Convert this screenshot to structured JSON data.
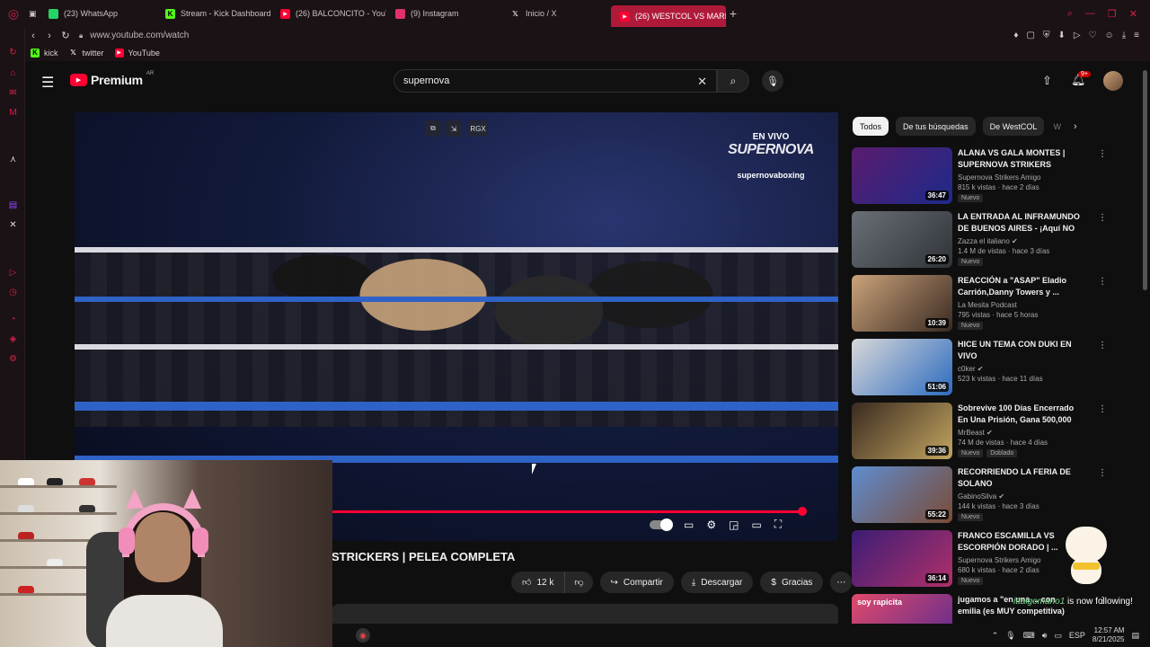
{
  "browser": {
    "tabs": [
      {
        "label": "(23) WhatsApp",
        "icon": "whatsapp-icon",
        "color": "#25d366"
      },
      {
        "label": "Stream - Kick Dashboard",
        "icon": "kick-icon",
        "color": "#53fc18"
      },
      {
        "label": "(26) BALCONCITO - YouT",
        "icon": "youtube-icon",
        "color": "#ff0033"
      },
      {
        "label": "(9) Instagram",
        "icon": "instagram-icon",
        "color": "#e1306c"
      },
      {
        "label": "Inicio / X",
        "icon": "x-icon",
        "color": "#ffffff"
      },
      {
        "label": "(26) WESTCOL VS MARIO",
        "icon": "youtube-icon",
        "color": "#ff0033",
        "active": true
      }
    ],
    "url": "www.youtube.com/watch",
    "bookmarks": [
      {
        "label": "kick",
        "icon": "kick-icon",
        "color": "#53fc18"
      },
      {
        "label": "twitter",
        "icon": "x-icon",
        "color": "#ffffff"
      },
      {
        "label": "YouTube",
        "icon": "youtube-icon",
        "color": "#ff0033"
      }
    ]
  },
  "youtube": {
    "logo_text": "Premium",
    "logo_region": "AR",
    "search_value": "supernova",
    "notification_count": "9+",
    "player": {
      "overlay_label": "RGX",
      "watermark_live": "EN VIVO",
      "watermark_brand": "SUPERNOVA",
      "watermark_handle": "supernovaboxing",
      "progress": 0.99
    },
    "video_title": "STRICKERS | PELEA COMPLETA",
    "actions": {
      "likes": "12 k",
      "share": "Compartir",
      "download": "Descargar",
      "thanks": "Gracias"
    },
    "chips": [
      "Todos",
      "De tus búsquedas",
      "De WestCOL",
      "W"
    ],
    "recommendations": [
      {
        "title": "ALANA VS GALA MONTES | SUPERNOVA STRIKERS AMIGO",
        "channel": "Supernova Strikers Amigo",
        "verified": false,
        "meta": "815 k vistas · hace 2 días",
        "duration": "36:47",
        "badges": [
          "Nuevo"
        ],
        "thumb": [
          "#5a1c6e",
          "#1d2a8a"
        ]
      },
      {
        "title": "LA ENTRADA AL INFRAMUNDO DE BUENOS AIRES - ¡Aquí NO ...",
        "channel": "Zazza el italiano",
        "verified": true,
        "meta": "1.4 M de vistas · hace 3 días",
        "duration": "26:20",
        "badges": [
          "Nuevo"
        ],
        "thumb": [
          "#6a6f77",
          "#2f3338"
        ]
      },
      {
        "title": "REACCIÓN a \"ASAP\" Eladio Carrión,Danny Towers y ...",
        "channel": "La Mesita Podcast",
        "verified": false,
        "meta": "795 vistas · hace 5 horas",
        "duration": "10:39",
        "badges": [
          "Nuevo"
        ],
        "thumb": [
          "#caa37a",
          "#3a2a22"
        ]
      },
      {
        "title": "HICE UN TEMA CON DUKI EN VIVO",
        "channel": "c0ker",
        "verified": true,
        "meta": "523 k vistas · hace 11 días",
        "duration": "51:06",
        "badges": [],
        "thumb": [
          "#d8d8d8",
          "#2c6bbf"
        ]
      },
      {
        "title": "Sobrevive 100 Días Encerrado En Una Prisión, Gana 500,000 ...",
        "channel": "MrBeast",
        "verified": true,
        "meta": "74 M de vistas · hace 4 días",
        "duration": "39:36",
        "badges": [
          "Nuevo",
          "Doblado"
        ],
        "thumb": [
          "#3a2a20",
          "#c2a560"
        ]
      },
      {
        "title": "RECORRIENDO LA FERIA DE SOLANO",
        "channel": "GabinoSilva",
        "verified": true,
        "meta": "144 k vistas · hace 3 días",
        "duration": "55:22",
        "badges": [
          "Nuevo"
        ],
        "thumb": [
          "#5f8dd0",
          "#7a4b35"
        ]
      },
      {
        "title": "FRANCO ESCAMILLA VS ESCORPIÓN DORADO | ...",
        "channel": "Supernova Strikers Amigo",
        "verified": false,
        "meta": "680 k vistas · hace 2 días",
        "duration": "36:14",
        "badges": [
          "Nuevo"
        ],
        "thumb": [
          "#3b1d75",
          "#b0306a"
        ]
      },
      {
        "title": "jugamos a \"en una ... con emilia (es MUY competitiva)",
        "channel": "",
        "verified": false,
        "meta": "",
        "duration": "",
        "badges": [],
        "thumb": [
          "#e04a6b",
          "#5a2a90"
        ],
        "thumb_text": "soy rapicita"
      }
    ]
  },
  "stream_overlay": {
    "follow_user": "ittaigomano1",
    "follow_text": "is now following!"
  },
  "taskbar": {
    "lang": "ESP",
    "time": "12:57 AM",
    "date": "8/21/2025"
  },
  "colors": {
    "accent": "#d6224a",
    "youtube_red": "#ff0033",
    "bg": "#0f0f0f"
  }
}
